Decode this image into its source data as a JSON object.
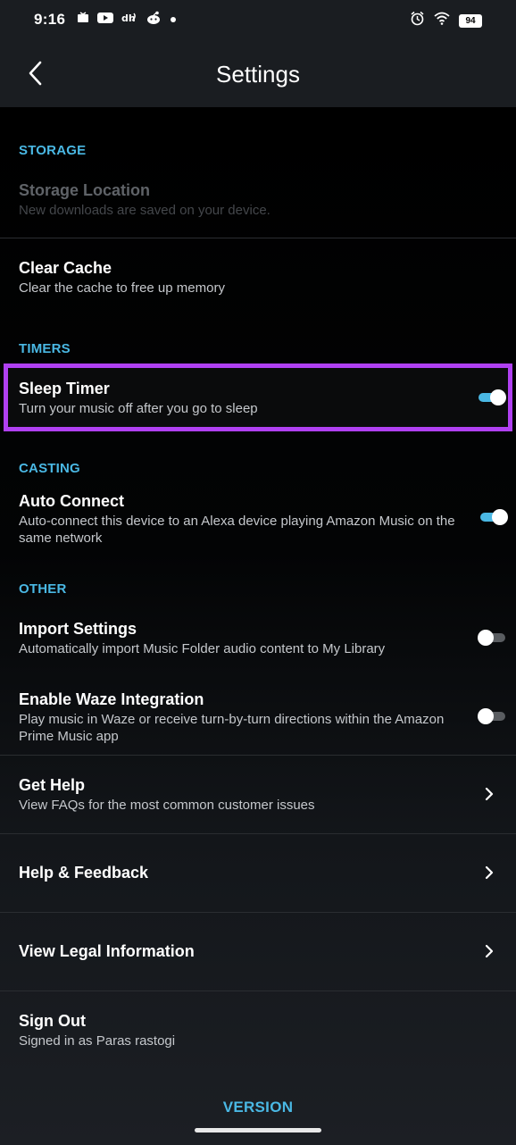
{
  "status_bar": {
    "time": "9:16",
    "battery": "94",
    "left_icons": [
      "media-icon",
      "youtube-icon",
      "link-icon",
      "reddit-icon",
      "dot-icon"
    ],
    "right_icons": [
      "alarm-icon",
      "wifi-icon",
      "battery-icon"
    ]
  },
  "header": {
    "title": "Settings"
  },
  "sections": {
    "storage": "STORAGE",
    "timers": "TIMERS",
    "casting": "CASTING",
    "other": "OTHER"
  },
  "rows": {
    "storage_location": {
      "title": "Storage Location",
      "subtitle": "New downloads are saved on your device.",
      "enabled": false
    },
    "clear_cache": {
      "title": "Clear Cache",
      "subtitle": "Clear the cache to free up memory"
    },
    "sleep_timer": {
      "title": "Sleep Timer",
      "subtitle": "Turn your music off after you go to sleep",
      "toggle": "on"
    },
    "auto_connect": {
      "title": "Auto Connect",
      "subtitle": "Auto-connect this device to an Alexa device playing Amazon Music on the same network",
      "toggle": "on"
    },
    "import_settings": {
      "title": "Import Settings",
      "subtitle": "Automatically import Music Folder audio content to My Library",
      "toggle": "off"
    },
    "waze": {
      "title": "Enable Waze Integration",
      "subtitle": "Play music in Waze or receive turn-by-turn directions within the Amazon Prime Music app",
      "toggle": "off"
    },
    "get_help": {
      "title": "Get Help",
      "subtitle": "View FAQs for the most common customer issues"
    },
    "help_feedback": {
      "title": "Help & Feedback"
    },
    "legal": {
      "title": "View Legal Information"
    },
    "sign_out": {
      "title": "Sign Out",
      "subtitle": "Signed in as Paras rastogi"
    }
  },
  "footer": {
    "version_label": "VERSION"
  },
  "colors": {
    "accent": "#4ab8e4",
    "highlight": "#b040f2",
    "background": "#000000",
    "header": "#1a1d21"
  }
}
